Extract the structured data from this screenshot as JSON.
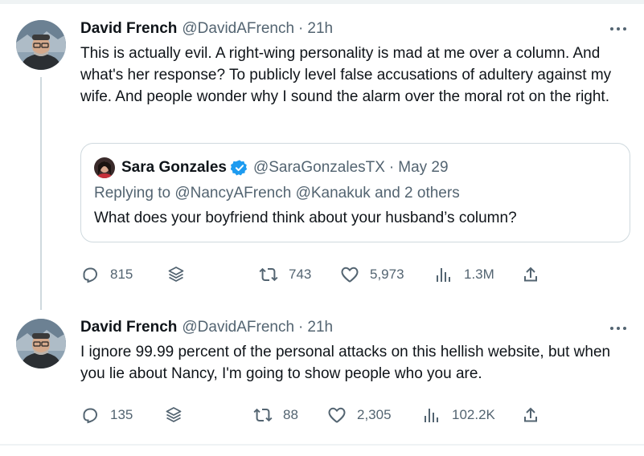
{
  "tweets": [
    {
      "author_name": "David French",
      "handle": "@DavidAFrench",
      "separator": "·",
      "time": "21h",
      "text": "This is actually evil. A right-wing personality is mad at me over a column. And what's her response? To publicly level false accusations of adultery against my wife.  And people wonder why I sound the alarm over the moral rot on the right.",
      "quote": {
        "author_name": "Sara Gonzales",
        "handle": "@SaraGonzalesTX",
        "separator": "·",
        "date": "May 29",
        "replying_to": "Replying to @NancyAFrench @Kanakuk and 2 others",
        "text": "What does your boyfriend think about your husband’s column?"
      },
      "stats": {
        "replies": "815",
        "retweets": "743",
        "likes": "5,973",
        "views": "1.3M"
      }
    },
    {
      "author_name": "David French",
      "handle": "@DavidAFrench",
      "separator": "·",
      "time": "21h",
      "text": "I ignore 99.99 percent of the personal attacks on this hellish website, but when you lie about Nancy, I'm going to show people who you are.",
      "stats": {
        "replies": "135",
        "retweets": "88",
        "likes": "2,305",
        "views": "102.2K"
      }
    }
  ],
  "icons": {
    "reply": "reply-icon",
    "stack": "stack-icon",
    "retweet": "retweet-icon",
    "like": "heart-icon",
    "views": "views-icon",
    "share": "share-icon",
    "more": "more-icon",
    "verified": "verified-badge-icon"
  },
  "colors": {
    "text_primary": "#0f1419",
    "text_secondary": "#536471",
    "border": "#cfd9de",
    "verified": "#1d9bf0"
  }
}
